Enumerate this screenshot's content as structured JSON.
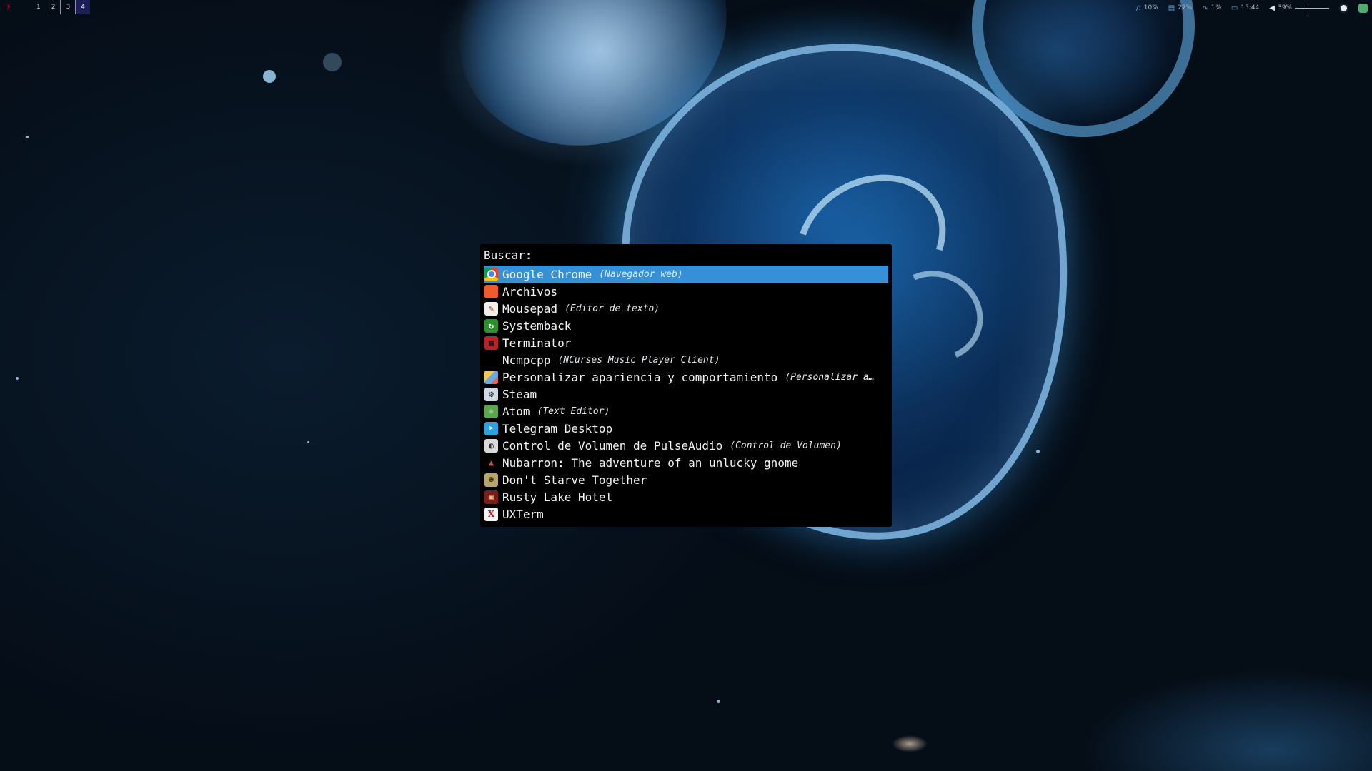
{
  "topbar": {
    "workspaces": [
      "1",
      "2",
      "3",
      "4"
    ],
    "active_workspace": "4",
    "tray": {
      "disk": "10%",
      "memory": "27%",
      "cpu": "1%",
      "clock": "15:44",
      "volume": "39%"
    }
  },
  "launcher": {
    "prompt": "Buscar:",
    "selected_index": 0,
    "items": [
      {
        "icon": "chrome-icon",
        "name": "Google Chrome",
        "desc": "(Navegador web)"
      },
      {
        "icon": "folder-icon",
        "name": "Archivos",
        "desc": ""
      },
      {
        "icon": "text-editor-icon",
        "name": "Mousepad",
        "desc": "(Editor de texto)"
      },
      {
        "icon": "systemback-icon",
        "name": "Systemback",
        "desc": ""
      },
      {
        "icon": "terminal-icon",
        "name": "Terminator",
        "desc": ""
      },
      {
        "icon": "",
        "name": "Ncmpcpp",
        "desc": "(NCurses Music Player Client)"
      },
      {
        "icon": "appearance-icon",
        "name": "Personalizar apariencia y comportamiento",
        "desc": "(Personalizar a…"
      },
      {
        "icon": "steam-icon",
        "name": "Steam",
        "desc": ""
      },
      {
        "icon": "atom-icon",
        "name": "Atom",
        "desc": "(Text Editor)"
      },
      {
        "icon": "telegram-icon",
        "name": "Telegram Desktop",
        "desc": ""
      },
      {
        "icon": "volume-control-icon",
        "name": "Control de Volumen de PulseAudio",
        "desc": "(Control de Volumen)"
      },
      {
        "icon": "gnome-hat-icon",
        "name": "Nubarron: The adventure of an unlucky gnome",
        "desc": ""
      },
      {
        "icon": "dont-starve-icon",
        "name": "Don't Starve Together",
        "desc": ""
      },
      {
        "icon": "rusty-lake-icon",
        "name": "Rusty Lake Hotel",
        "desc": ""
      },
      {
        "icon": "uxterm-icon",
        "name": "UXTerm",
        "desc": ""
      }
    ]
  },
  "colors": {
    "selection": "#3590d6",
    "launcher_bg": "#000000",
    "active_workspace_bg": "#1b1f55",
    "bolt": "#e21b3c"
  }
}
